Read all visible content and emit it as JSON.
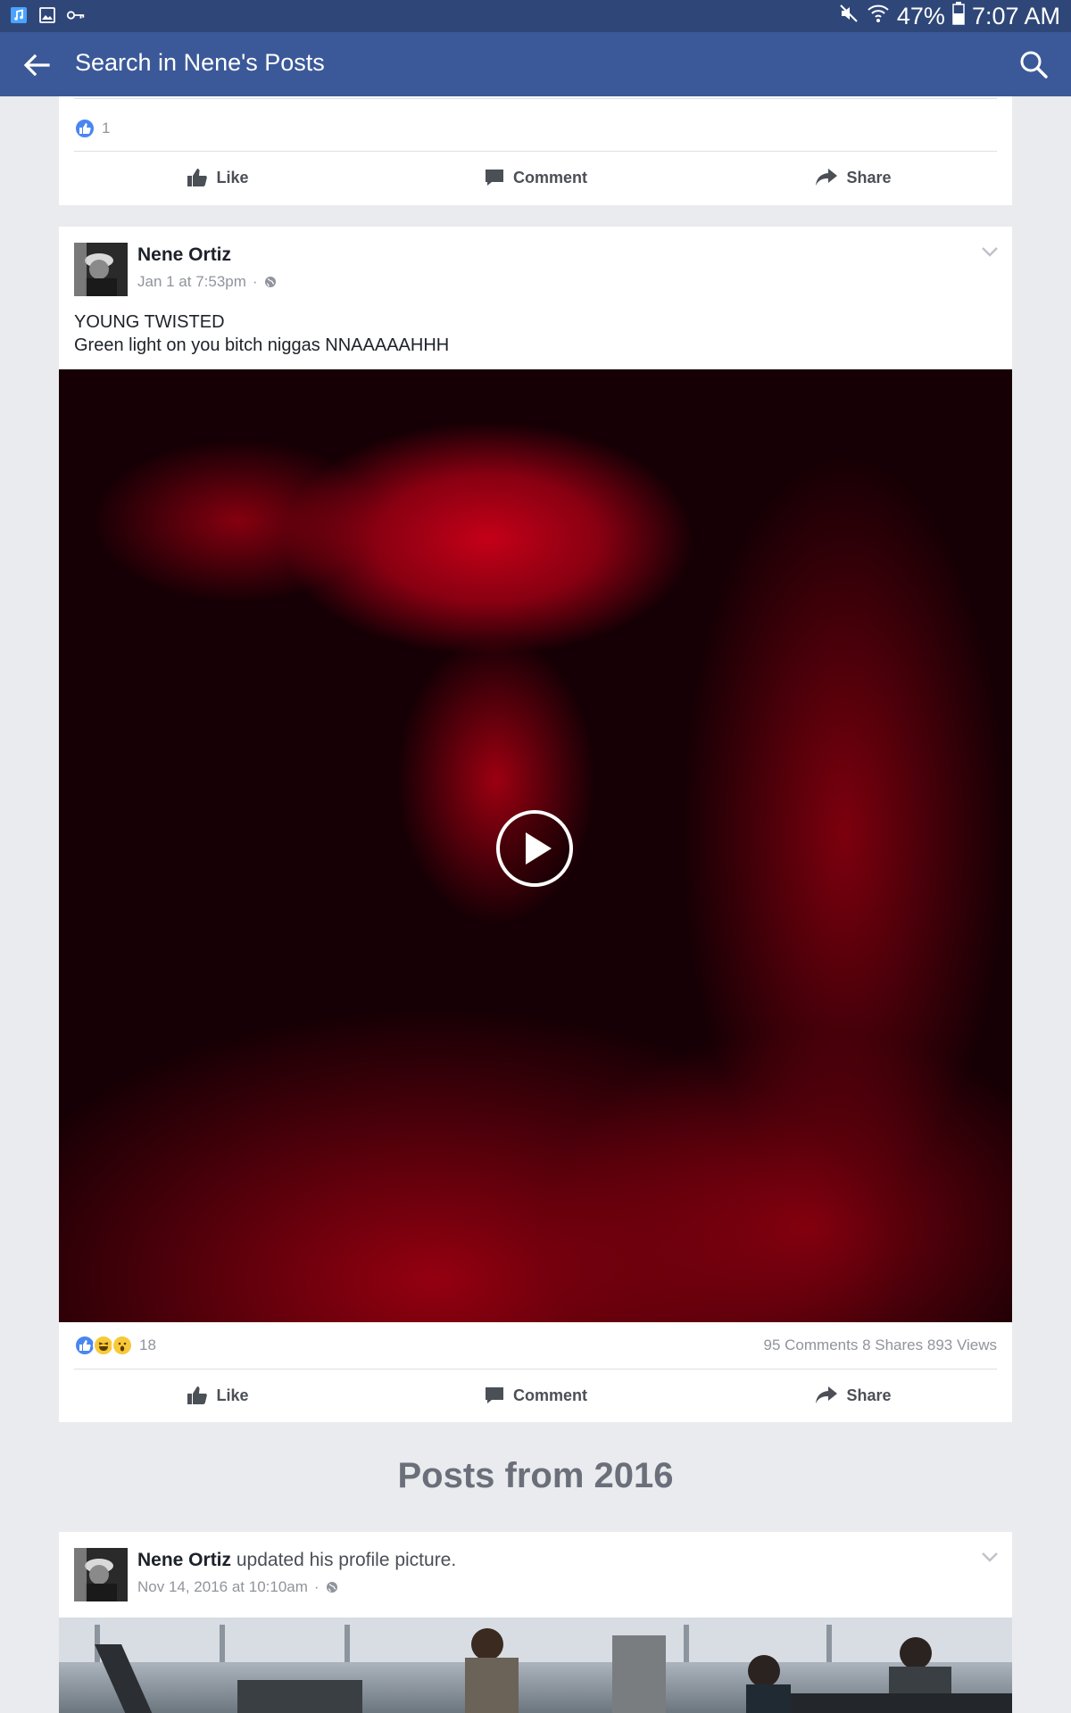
{
  "status_bar": {
    "left_icons": [
      "music-icon",
      "image-icon",
      "key-icon"
    ],
    "battery_percent": "47%",
    "time": "7:07 AM",
    "right_icons": [
      "mute-icon",
      "wifi-icon",
      "battery-icon"
    ]
  },
  "app_bar": {
    "title": "Search in Nene's Posts",
    "icons": [
      "back-arrow-icon",
      "search-icon"
    ]
  },
  "previous_post": {
    "reaction_count": "1",
    "actions": {
      "like": "Like",
      "comment": "Comment",
      "share": "Share"
    }
  },
  "post": {
    "author": "Nene Ortiz",
    "timestamp": "Jan 1 at 7:53pm",
    "separator": "·",
    "text_line1": "YOUNG TWISTED",
    "text_line2": "Green light on you bitch niggas NNAAAAAHHH",
    "media": "video",
    "reaction_count": "18",
    "comments": "95 Comments",
    "shares": "8 Shares",
    "views": "893 Views",
    "actions": {
      "like": "Like",
      "comment": "Comment",
      "share": "Share"
    }
  },
  "section": {
    "title": "Posts from 2016"
  },
  "post2": {
    "author": "Nene Ortiz",
    "activity": "updated his profile picture.",
    "timestamp": "Nov 14, 2016 at 10:10am",
    "separator": "·"
  },
  "colors": {
    "facebook_blue": "#3b5998",
    "status_bar": "#2f4778",
    "background": "#e9ebee",
    "action_text": "#4b4f56",
    "meta_text": "#90949c"
  }
}
